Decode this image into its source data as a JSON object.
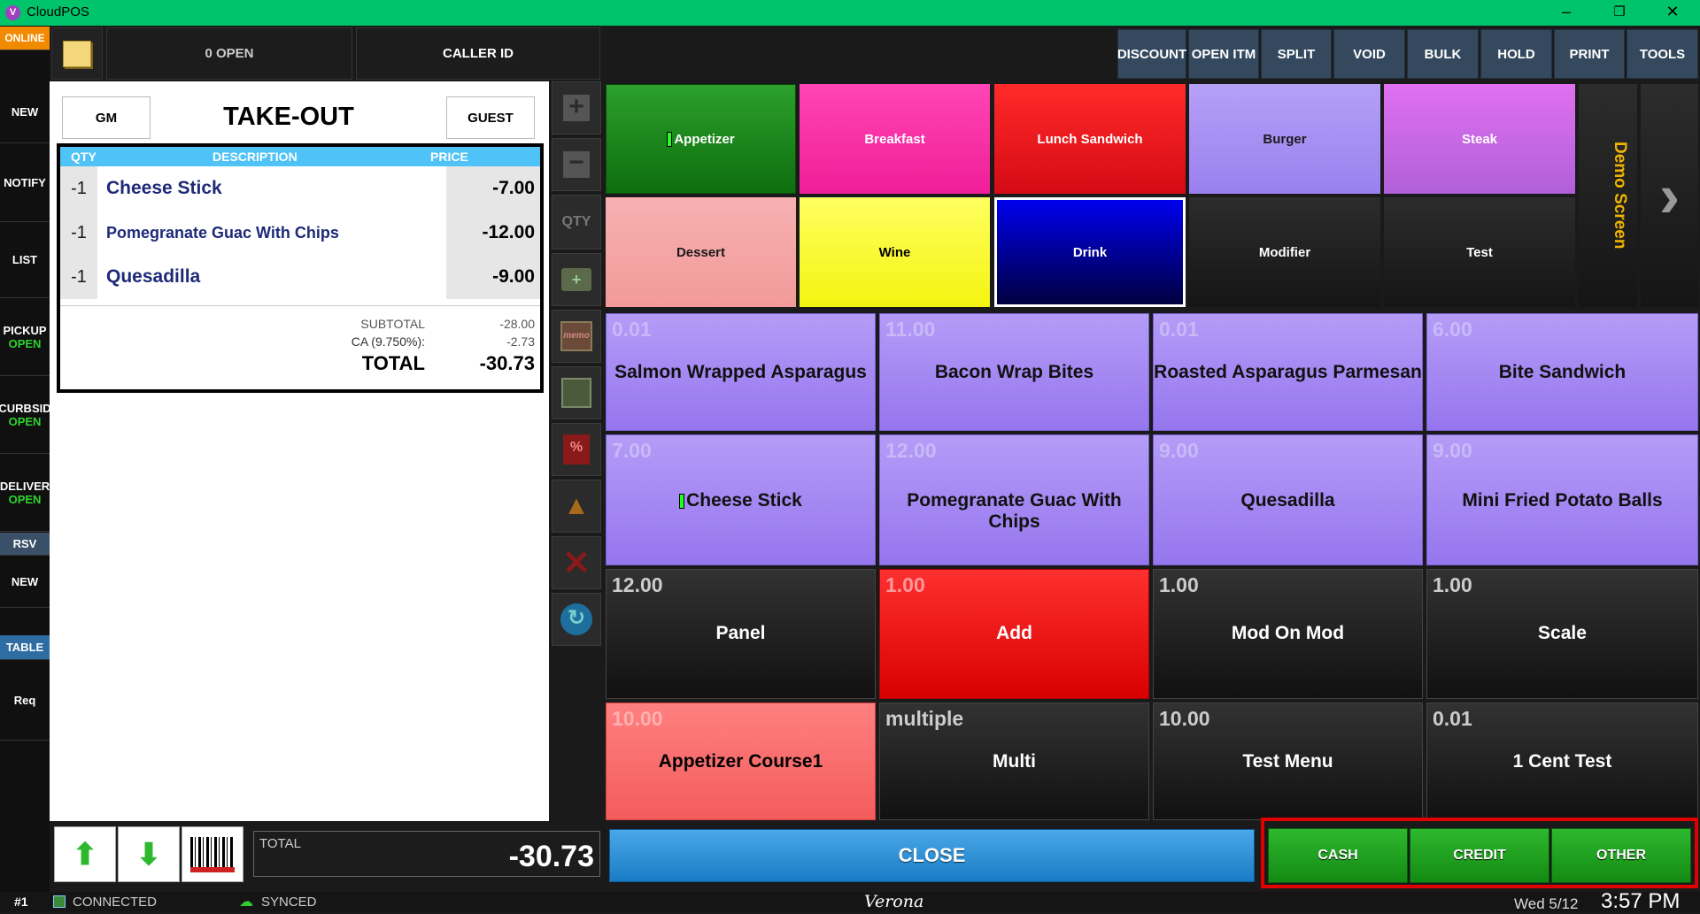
{
  "window": {
    "title": "CloudPOS",
    "app_icon": "V"
  },
  "sidebar": {
    "online": "ONLINE",
    "items": [
      {
        "label": "NEW",
        "sub": ""
      },
      {
        "label": "NOTIFY",
        "sub": ""
      },
      {
        "label": "LIST",
        "sub": ""
      },
      {
        "label": "PICKUP",
        "sub": "OPEN"
      },
      {
        "label": "CURBSID",
        "sub": "OPEN"
      },
      {
        "label": "DELIVER",
        "sub": "OPEN"
      },
      {
        "label": "RSV",
        "sub": ""
      },
      {
        "label": "NEW",
        "sub": ""
      },
      {
        "label": "TABLE",
        "sub": ""
      },
      {
        "label": "Req",
        "sub": ""
      }
    ]
  },
  "topbar": {
    "open_count": "0 OPEN",
    "caller_id": "CALLER ID",
    "tools": [
      "DISCOUNT",
      "OPEN ITM",
      "SPLIT",
      "VOID",
      "BULK",
      "HOLD",
      "PRINT",
      "TOOLS"
    ]
  },
  "order": {
    "gm": "GM",
    "type": "TAKE-OUT",
    "guest": "GUEST",
    "columns": {
      "qty": "QTY",
      "description": "DESCRIPTION",
      "price": "PRICE"
    },
    "lines": [
      {
        "qty": "-1",
        "description": "Cheese Stick",
        "price": "-7.00"
      },
      {
        "qty": "-1",
        "description": "Pomegranate Guac With Chips",
        "price": "-12.00"
      },
      {
        "qty": "-1",
        "description": "Quesadilla",
        "price": "-9.00"
      }
    ],
    "subtotal_label": "SUBTOTAL",
    "subtotal": "-28.00",
    "tax_label": "CA (9.750%):",
    "tax": "-2.73",
    "total_label": "TOTAL",
    "total": "-30.73"
  },
  "toolcol": {
    "qty_label": "QTY"
  },
  "categories": [
    {
      "label": "Appetizer",
      "color": "#1e8c1e"
    },
    {
      "label": "Breakfast",
      "color": "#ff2ea8"
    },
    {
      "label": "Lunch Sandwich",
      "color": "#e8141e"
    },
    {
      "label": "Burger",
      "color": "#a78ef0"
    },
    {
      "label": "Steak",
      "color": "#c070e8"
    },
    {
      "label": "Dessert",
      "color": "#f4a2a2"
    },
    {
      "label": "Wine",
      "color": "#ffff22"
    },
    {
      "label": "Drink",
      "color": "#0000cc"
    },
    {
      "label": "Modifier",
      "color": "#222222"
    },
    {
      "label": "Test",
      "color": "#222222"
    }
  ],
  "screen_label": "Demo Screen",
  "items": [
    {
      "price": "0.01",
      "name": "Salmon Wrapped Asparagus"
    },
    {
      "price": "11.00",
      "name": "Bacon Wrap Bites"
    },
    {
      "price": "0.01",
      "name": "Roasted Asparagus Parmesan"
    },
    {
      "price": "6.00",
      "name": "Bite Sandwich"
    },
    {
      "price": "7.00",
      "name": "Cheese Stick"
    },
    {
      "price": "12.00",
      "name": "Pomegranate Guac With Chips"
    },
    {
      "price": "9.00",
      "name": "Quesadilla"
    },
    {
      "price": "9.00",
      "name": "Mini Fried Potato Balls"
    },
    {
      "price": "12.00",
      "name": "Panel"
    },
    {
      "price": "1.00",
      "name": "Add"
    },
    {
      "price": "1.00",
      "name": "Mod On Mod"
    },
    {
      "price": "1.00",
      "name": "Scale"
    },
    {
      "price": "10.00",
      "name": "Appetizer Course1"
    },
    {
      "price": "multiple",
      "name": "Multi"
    },
    {
      "price": "10.00",
      "name": "Test Menu"
    },
    {
      "price": "0.01",
      "name": "1 Cent Test"
    }
  ],
  "bottom": {
    "total_label": "TOTAL",
    "total": "-30.73",
    "close": "CLOSE",
    "cash": "CASH",
    "credit": "CREDIT",
    "other": "OTHER"
  },
  "status": {
    "terminal": "#1",
    "connected": "CONNECTED",
    "synced": "SYNCED",
    "location": "Verona",
    "date": "Wed 5/12",
    "time": "3:57 PM"
  }
}
